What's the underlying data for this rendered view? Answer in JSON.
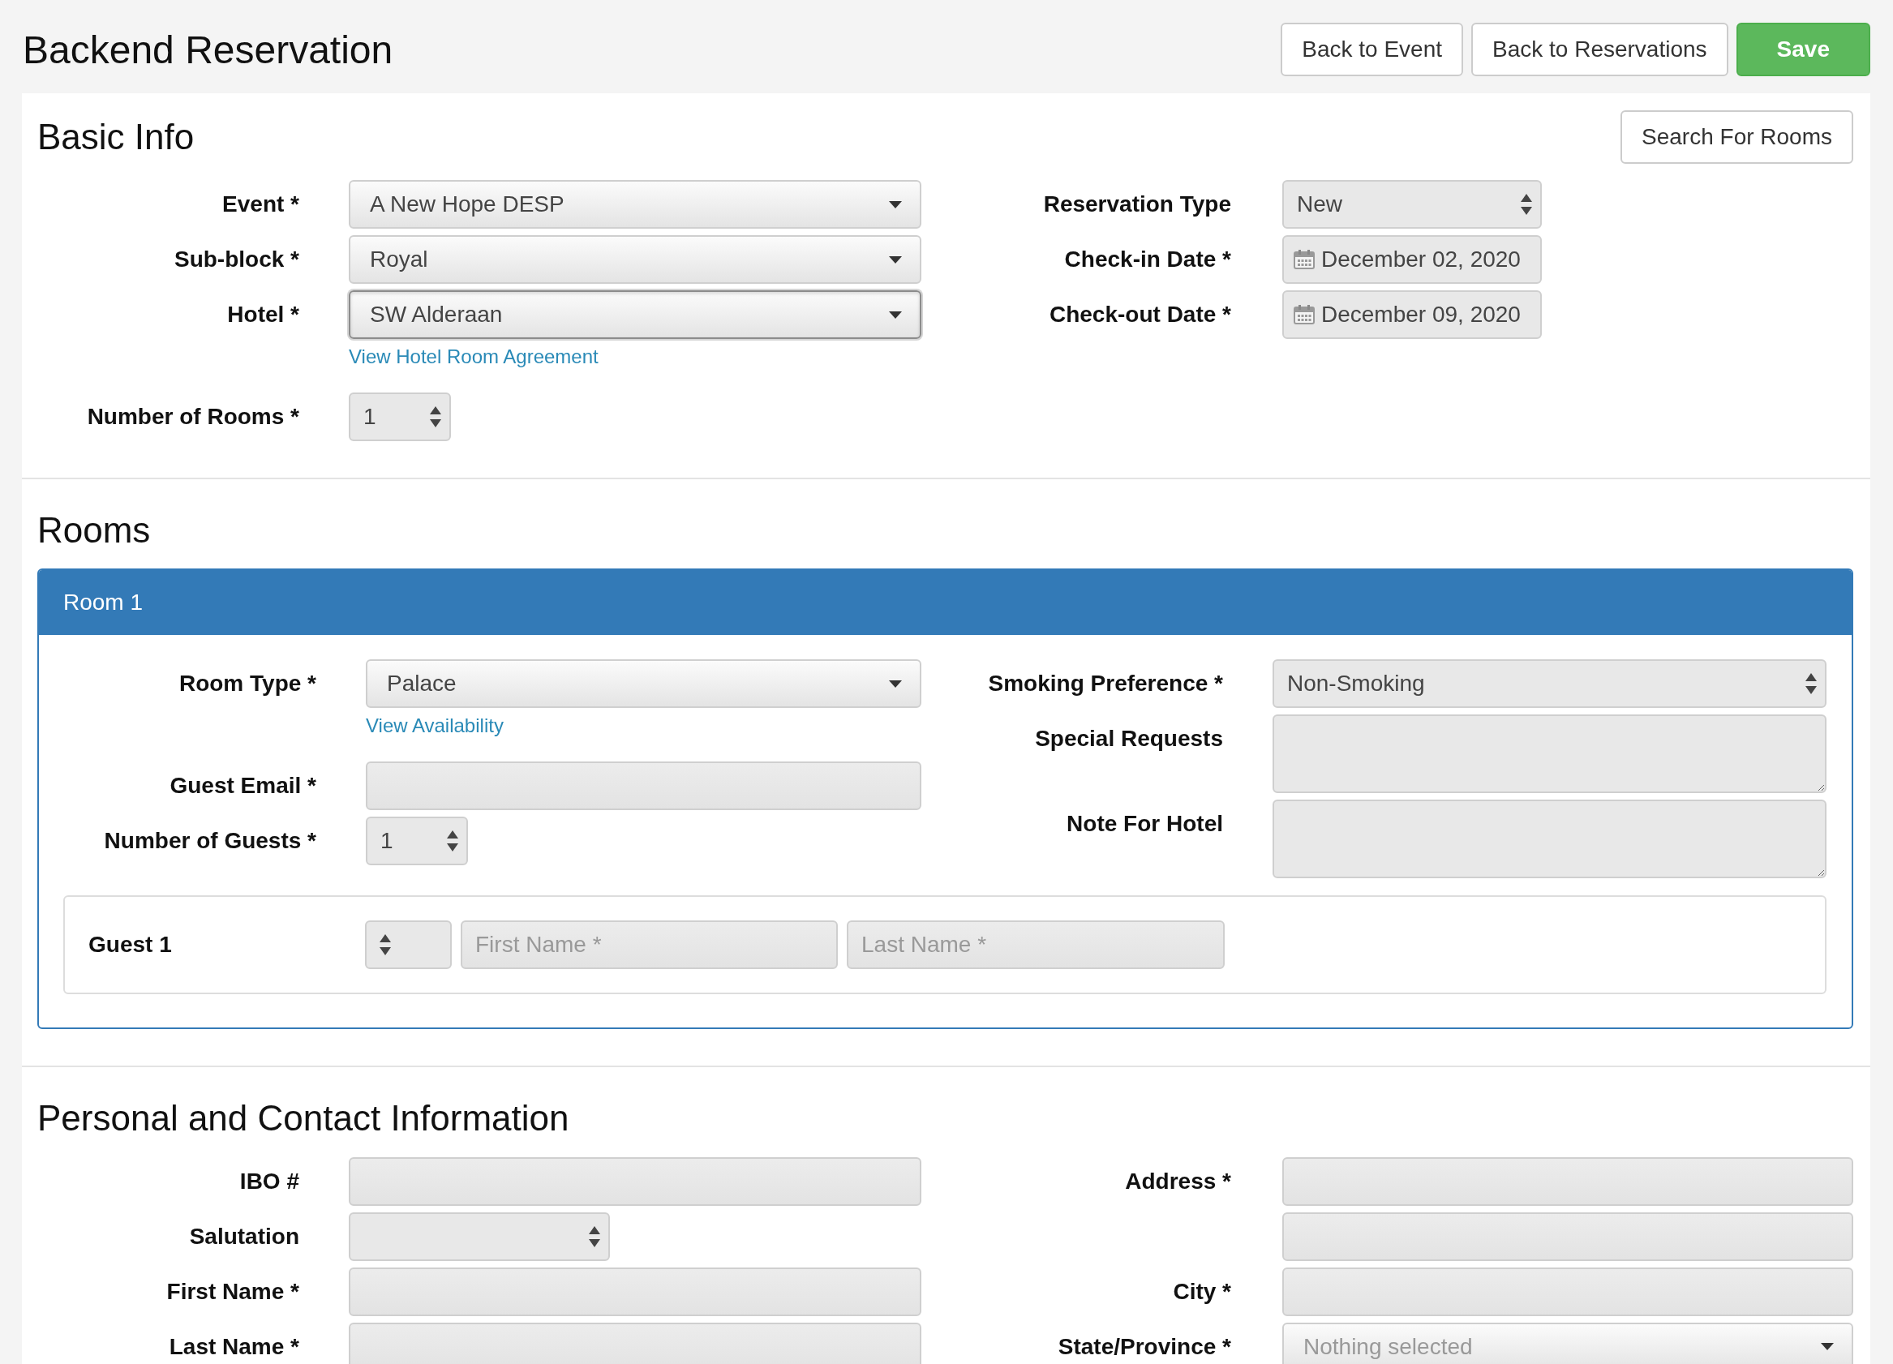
{
  "page_title": "Backend Reservation",
  "header_buttons": [
    {
      "label": "Back to Event",
      "kind": "default"
    },
    {
      "label": "Back to Reservations",
      "kind": "default"
    },
    {
      "label": "Save",
      "kind": "primary"
    }
  ],
  "basic_info": {
    "title": "Basic Info",
    "search_button": "Search For Rooms",
    "left_fields": [
      {
        "label": "Event *",
        "kind": "dropdown",
        "value": "A New Hope DESP",
        "focused": false
      },
      {
        "label": "Sub-block *",
        "kind": "dropdown",
        "value": "Royal",
        "focused": false
      },
      {
        "label": "Hotel *",
        "kind": "dropdown",
        "value": "SW Alderaan",
        "focused": true,
        "link": "View Hotel Room Agreement"
      },
      {
        "label": "Number of Rooms *",
        "kind": "spinner",
        "value": "1"
      }
    ],
    "right_fields": [
      {
        "label": "Reservation Type",
        "kind": "select",
        "value": "New"
      },
      {
        "label": "Check-in Date *",
        "kind": "date",
        "value": "December 02, 2020"
      },
      {
        "label": "Check-out Date *",
        "kind": "date",
        "value": "December 09, 2020"
      }
    ]
  },
  "rooms": {
    "title": "Rooms",
    "panels": [
      {
        "title": "Room 1",
        "left_fields": [
          {
            "label": "Room Type *",
            "kind": "dropdown",
            "value": "Palace",
            "focused": false,
            "link": "View Availability"
          },
          {
            "label": "Guest Email *",
            "kind": "text"
          },
          {
            "label": "Number of Guests *",
            "kind": "spinner",
            "value": "1"
          }
        ],
        "right_fields": [
          {
            "label": "Smoking Preference *",
            "kind": "select",
            "value": "Non-Smoking"
          },
          {
            "label": "Special Requests",
            "kind": "textarea"
          },
          {
            "label": "Note For Hotel",
            "kind": "textarea"
          }
        ],
        "guests": [
          {
            "label": "Guest 1",
            "first_name_placeholder": "First Name *",
            "last_name_placeholder": "Last Name *"
          }
        ]
      }
    ]
  },
  "personal": {
    "title": "Personal and Contact Information",
    "left_fields": [
      {
        "label": "IBO #",
        "kind": "text"
      },
      {
        "label": "Salutation",
        "kind": "short-select"
      },
      {
        "label": "First Name *",
        "kind": "text"
      },
      {
        "label": "Last Name *",
        "kind": "text"
      }
    ],
    "right_fields": [
      {
        "label": "Address *",
        "kind": "text"
      },
      {
        "kind": "text"
      },
      {
        "label": "City *",
        "kind": "text"
      },
      {
        "label": "State/Province *",
        "kind": "dropdown",
        "placeholder": "Nothing selected",
        "focused": false
      }
    ]
  }
}
